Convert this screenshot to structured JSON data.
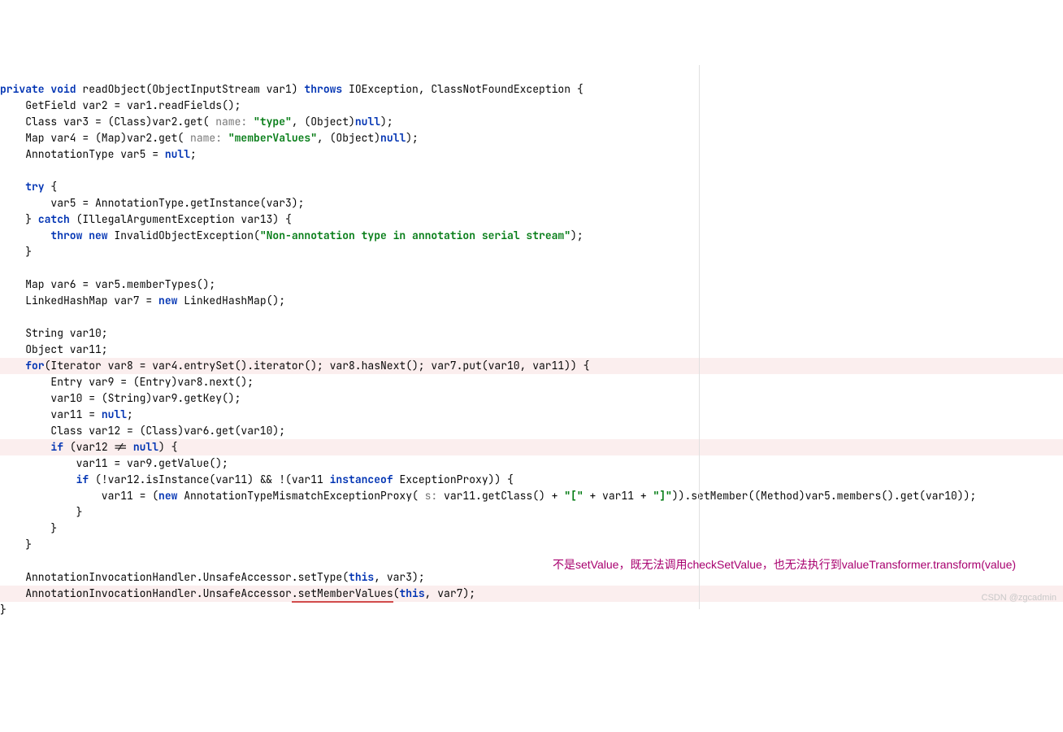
{
  "code": {
    "l1a": "private void ",
    "l1b": "readObject(ObjectInputStream var1) ",
    "l1c": "throws ",
    "l1d": "IOException, ClassNotFoundException {",
    "l2": "    GetField var2 = var1.readFields();",
    "l3a": "    Class var3 = (Class)var2.get( ",
    "l3h": "name: ",
    "l3b": "\"type\"",
    "l3c": ", (Object)",
    "l3d": "null",
    "l3e": ");",
    "l4a": "    Map var4 = (Map)var2.get( ",
    "l4h": "name: ",
    "l4b": "\"memberValues\"",
    "l4c": ", (Object)",
    "l4d": "null",
    "l4e": ");",
    "l5a": "    AnnotationType var5 = ",
    "l5b": "null",
    "l5c": ";",
    "l6": "",
    "l7a": "    try ",
    "l7b": "{",
    "l8": "        var5 = AnnotationType.getInstance(var3);",
    "l9a": "    } ",
    "l9b": "catch ",
    "l9c": "(IllegalArgumentException var13) {",
    "l10a": "        throw new ",
    "l10b": "InvalidObjectException(",
    "l10c": "\"Non-annotation type in annotation serial stream\"",
    "l10d": ");",
    "l11": "    }",
    "l12": "",
    "l13": "    Map var6 = var5.memberTypes();",
    "l14a": "    LinkedHashMap var7 = ",
    "l14b": "new ",
    "l14c": "LinkedHashMap();",
    "l15": "",
    "l16": "    String var10;",
    "l17": "    Object var11;",
    "l18a": "    for",
    "l18b": "(Iterator var8 = var4.entrySet().iterator(); var8.hasNext(); var7.put(var10, var11)) {",
    "l19": "        Entry var9 = (Entry)var8.next();",
    "l20": "        var10 = (String)var9.getKey();",
    "l21a": "        var11 = ",
    "l21b": "null",
    "l21c": ";",
    "l22": "        Class var12 = (Class)var6.get(var10);",
    "l23a": "        if ",
    "l23b": "(var12 != ",
    "l23c": "null",
    "l23d": ") {",
    "l24": "            var11 = var9.getValue();",
    "l25a": "            if ",
    "l25b": "(!var12.isInstance(var11) && !(var11 ",
    "l25c": "instanceof ",
    "l25d": "ExceptionProxy)) {",
    "l26a": "                var11 = (",
    "l26b": "new ",
    "l26c": "AnnotationTypeMismatchExceptionProxy( ",
    "l26h": "s: ",
    "l26d": "var11.getClass() + ",
    "l26e": "\"[\"",
    "l26f": " + var11 + ",
    "l26g": "\"]\"",
    "l26i": ")).setMember((Method)var5.members().get(var10));",
    "l27": "            }",
    "l28": "        }",
    "l29": "    }",
    "l30": "",
    "l31a": "    AnnotationInvocationHandler.UnsafeAccessor.setType(",
    "l31b": "this",
    "l31c": ", var3);",
    "l32a": "    AnnotationInvocationHandler.UnsafeAccessor",
    "l32b": ".setMemberValues",
    "l32c": "(",
    "l32d": "this",
    "l32e": ", var7);",
    "l33": "}"
  },
  "comment": "不是setValue，既无法调用checkSetValue，也无法执行到valueTransformer.transform(value)",
  "watermark": "CSDN @zgcadmin"
}
